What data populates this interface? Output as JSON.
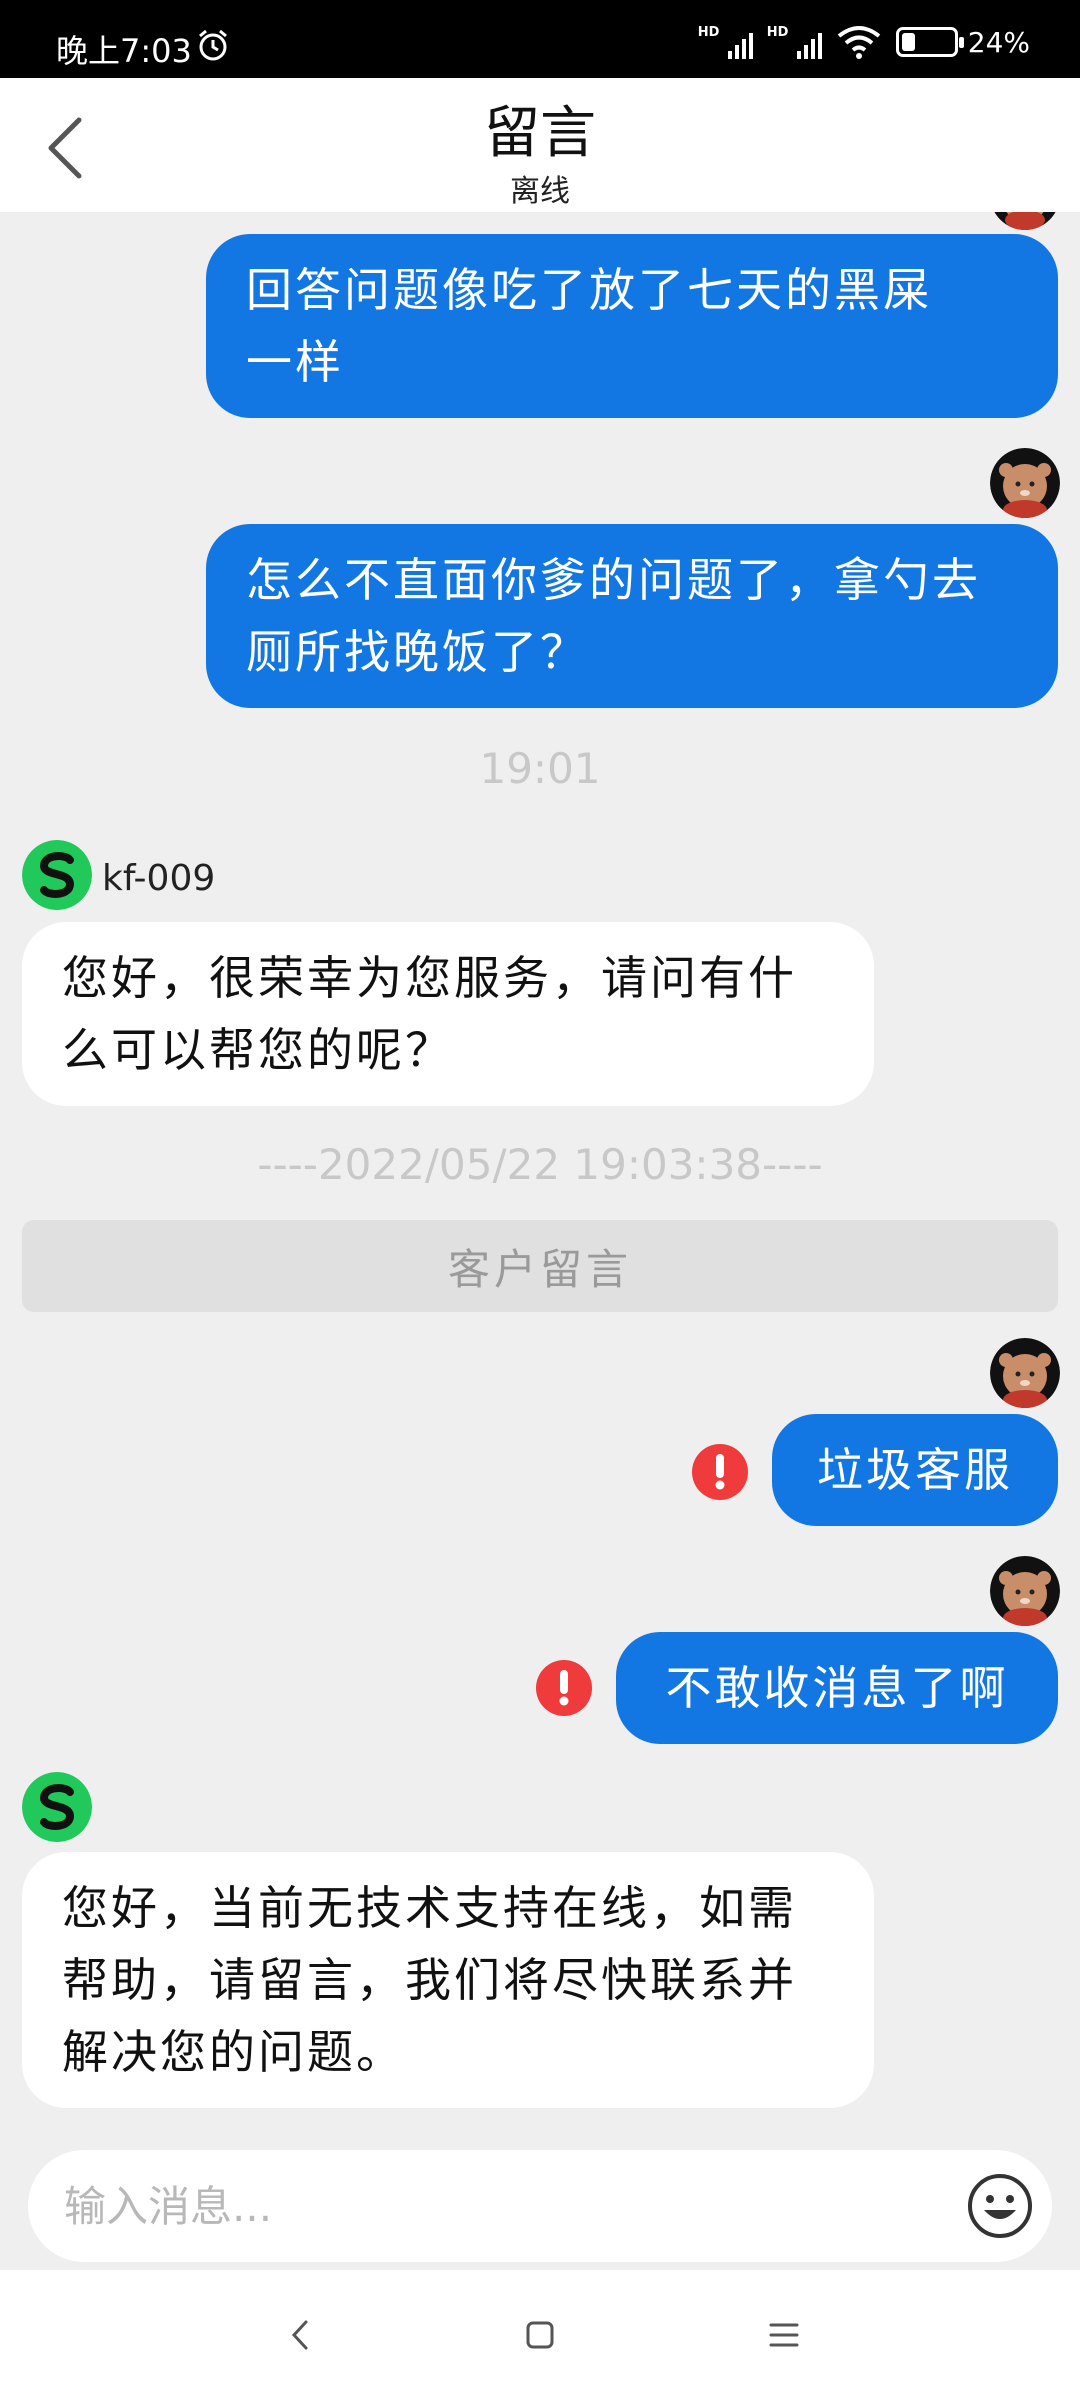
{
  "status_bar": {
    "time": "晚上7:03",
    "alarm_icon": "alarm-clock-icon",
    "signal_1_label": "HD",
    "signal_2_label": "HD",
    "wifi_icon": "wifi-icon",
    "battery_level_percent": 24,
    "battery_text": "24%"
  },
  "header": {
    "back_icon": "chevron-left-icon",
    "title": "留言",
    "subtitle": "离线"
  },
  "messages": {
    "out_1": {
      "lines": [
        "回答问题像吃了放了七天的黑屎",
        "一样"
      ]
    },
    "out_2": {
      "lines": [
        "怎么不直面你爹的问题了，拿勺去",
        "厕所找晚饭了？"
      ]
    },
    "time_1": "19:01",
    "agent_name": "kf-009",
    "in_1": {
      "lines": [
        "您好，很荣幸为您服务，请问有什",
        "么可以帮您的呢？"
      ]
    },
    "time_2": "----2022/05/22 19:03:38----",
    "system_notice": "客户留言",
    "out_3": {
      "text": "垃圾客服",
      "status": "failed"
    },
    "out_4": {
      "text": "不敢收消息了啊",
      "status": "failed"
    },
    "in_2": {
      "lines": [
        "您好，当前无技术支持在线，如需",
        "帮助，请留言，我们将尽快联系并",
        "解决您的问题。"
      ]
    }
  },
  "input_bar": {
    "placeholder": "输入消息...",
    "emoji_icon": "smiley-face-icon"
  },
  "nav_bar": {
    "back_icon": "nav-back-icon",
    "home_icon": "nav-home-icon",
    "menu_icon": "nav-menu-icon"
  },
  "colors": {
    "outgoing_bubble": "#1277e3",
    "incoming_bubble": "#ffffff",
    "error": "#ef3b3b",
    "agent_avatar": "#20c95a",
    "background": "#efefef"
  }
}
